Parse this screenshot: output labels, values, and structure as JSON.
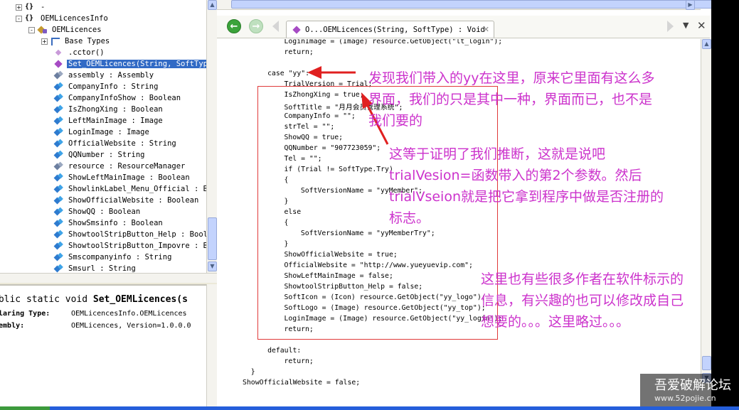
{
  "tree": {
    "items": [
      {
        "expander": "+",
        "icon": "namespace-icon",
        "icon_text": "{}",
        "label": "-"
      },
      {
        "expander": "-",
        "icon": "namespace-icon",
        "icon_text": "{}",
        "label": "OEMLicencesInfo"
      },
      {
        "expander": "-",
        "icon": "class-icon",
        "label": "OEMLicences"
      },
      {
        "expander": "+",
        "icon": "base-types-icon",
        "label": "Base Types"
      },
      {
        "icon": "constructor-icon",
        "label": ".cctor()"
      },
      {
        "icon": "method-icon",
        "label": "Set_OEMLicences(String, SoftType",
        "selected": true
      },
      {
        "icon": "field-icon",
        "label": "assembly : Assembly",
        "dim": true
      },
      {
        "icon": "field-icon",
        "label": "CompanyInfo : String"
      },
      {
        "icon": "field-icon",
        "label": "CompanyInfoShow : Boolean"
      },
      {
        "icon": "field-icon",
        "label": "IsZhongXing : Boolean"
      },
      {
        "icon": "field-icon",
        "label": "LeftMainImage : Image"
      },
      {
        "icon": "field-icon",
        "label": "LoginImage : Image"
      },
      {
        "icon": "field-icon",
        "label": "OfficialWebsite : String"
      },
      {
        "icon": "field-icon",
        "label": "QQNumber : String"
      },
      {
        "icon": "field-icon",
        "label": "resource : ResourceManager",
        "dim": true
      },
      {
        "icon": "field-icon",
        "label": "ShowLeftMainImage : Boolean"
      },
      {
        "icon": "field-icon",
        "label": "ShowlinkLabel_Menu_Official : Bo"
      },
      {
        "icon": "field-icon",
        "label": "ShowOfficialWebsite : Boolean"
      },
      {
        "icon": "field-icon",
        "label": "ShowQQ : Boolean"
      },
      {
        "icon": "field-icon",
        "label": "ShowSmsinfo : Boolean"
      },
      {
        "icon": "field-icon",
        "label": "ShowtoolStripButton_Help : Boole"
      },
      {
        "icon": "field-icon",
        "label": "ShowtoolStripButton_Impovre : Bo"
      },
      {
        "icon": "field-icon",
        "label": "Smscompanyinfo : String"
      },
      {
        "icon": "field-icon",
        "label": "Smsurl : String"
      }
    ]
  },
  "info": {
    "signature_prefix": "ublic static void ",
    "signature_name": "Set_OEMLicences(s",
    "declaring_type_label": "claring Type:",
    "declaring_type_value": "OEMLicencesInfo.OEMLicences",
    "assembly_label": "sembly:",
    "assembly_value": "OEMLicences, Version=1.0.0.0"
  },
  "toolbar": {
    "back_glyph": "←",
    "forward_glyph": "→",
    "tab_label": "O...OEMLicences(String, SoftType) : Void",
    "tab_close_glyph": "✕",
    "dropdown_glyph": "▼",
    "close_glyph": "✕"
  },
  "code": {
    "lines": [
      {
        "indent": 5,
        "text": "LoginImage = (Image) resource.GetObject(\"lt_login\");"
      },
      {
        "indent": 5,
        "text": "return;"
      },
      {
        "indent": 3,
        "text": ""
      },
      {
        "indent": 3,
        "text": "case \"yy\":"
      },
      {
        "indent": 5,
        "text": "TrialVersion = Trial;"
      },
      {
        "indent": 5,
        "text": "IsZhongXing = true;"
      },
      {
        "indent": 5,
        "text": "SoftTitle = \"月月会员管理系统\";"
      },
      {
        "indent": 5,
        "text": "CompanyInfo = \"\";"
      },
      {
        "indent": 5,
        "text": "strTel = \"\";"
      },
      {
        "indent": 5,
        "text": "ShowQQ = true;"
      },
      {
        "indent": 5,
        "text": "QQNumber = \"907723059\";"
      },
      {
        "indent": 5,
        "text": "Tel = \"\";"
      },
      {
        "indent": 5,
        "text": "if (Trial != SoftType.Try)"
      },
      {
        "indent": 5,
        "text": "{"
      },
      {
        "indent": 7,
        "text": "SoftVersionName = \"yyMember\";"
      },
      {
        "indent": 5,
        "text": "}"
      },
      {
        "indent": 5,
        "text": "else"
      },
      {
        "indent": 5,
        "text": "{"
      },
      {
        "indent": 7,
        "text": "SoftVersionName = \"yyMemberTry\";"
      },
      {
        "indent": 5,
        "text": "}"
      },
      {
        "indent": 5,
        "text": "ShowOfficialWebsite = true;"
      },
      {
        "indent": 5,
        "text": "OfficialWebsite = \"http://www.yueyuevip.com\";"
      },
      {
        "indent": 5,
        "text": "ShowLeftMainImage = false;"
      },
      {
        "indent": 5,
        "text": "ShowtoolStripButton_Help = false;"
      },
      {
        "indent": 5,
        "text": "SoftIcon = (Icon) resource.GetObject(\"yy_logo\");"
      },
      {
        "indent": 5,
        "text": "SoftLogo = (Image) resource.GetObject(\"yy_top\");"
      },
      {
        "indent": 5,
        "text": "LoginImage = (Image) resource.GetObject(\"yy_login\");"
      },
      {
        "indent": 5,
        "text": "return;"
      },
      {
        "indent": 3,
        "text": ""
      },
      {
        "indent": 3,
        "text": "default:"
      },
      {
        "indent": 5,
        "text": "return;"
      },
      {
        "indent": 1,
        "text": "}"
      },
      {
        "indent": 0,
        "text": "ShowOfficialWebsite = false;"
      }
    ]
  },
  "annotations": {
    "note1": "发现我们带入的yy在这里，原来它里面有这么多\n界面，我们的只是其中一种，界面而已，也不是\n我们要的",
    "note2": "这等于证明了我们推断，这就是说吧\ntrialVesion=函数带入的第2个参数。然后\ntrialVseion就是把它拿到程序中做是否注册的\n标志。",
    "note3": "这里也有些很多作者在软件标示的\n信息，有兴趣的也可以修改成自己\n想要的。。。这里略过。。。",
    "color": "#cc33cc"
  },
  "watermark": {
    "title": "吾爱破解论坛",
    "url": "www.52pojie.cn"
  }
}
